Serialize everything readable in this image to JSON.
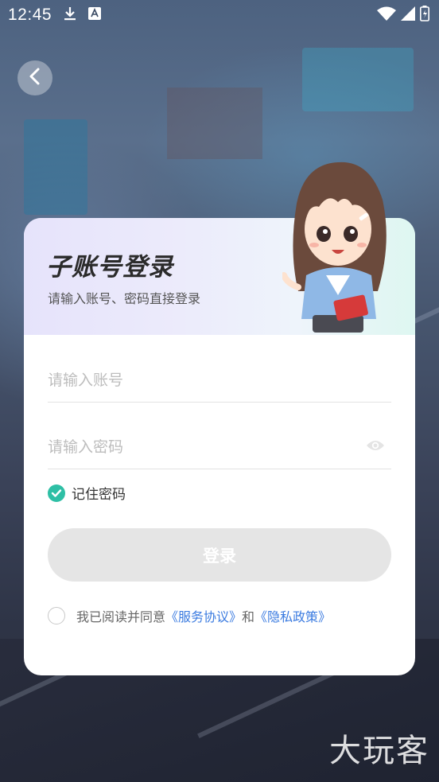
{
  "status_bar": {
    "time": "12:45",
    "icons": [
      "download-icon",
      "a-icon",
      "wifi-icon",
      "signal-icon",
      "battery-icon"
    ]
  },
  "nav": {
    "back_icon": "chevron-left-icon"
  },
  "card": {
    "title": "子账号登录",
    "subtitle": "请输入账号、密码直接登录"
  },
  "form": {
    "account_placeholder": "请输入账号",
    "account_value": "",
    "password_placeholder": "请输入密码",
    "password_value": "",
    "remember_label": "记住密码",
    "remember_checked": true,
    "login_label": "登录"
  },
  "agreement": {
    "prefix": "我已阅读并同意",
    "service_link": "《服务协议》",
    "and_text": "和",
    "privacy_link": "《隐私政策》",
    "checked": false
  },
  "watermark": "大玩客",
  "colors": {
    "accent": "#2ebfa5",
    "link": "#3b7be0",
    "login_disabled": "#e5e5e5"
  }
}
